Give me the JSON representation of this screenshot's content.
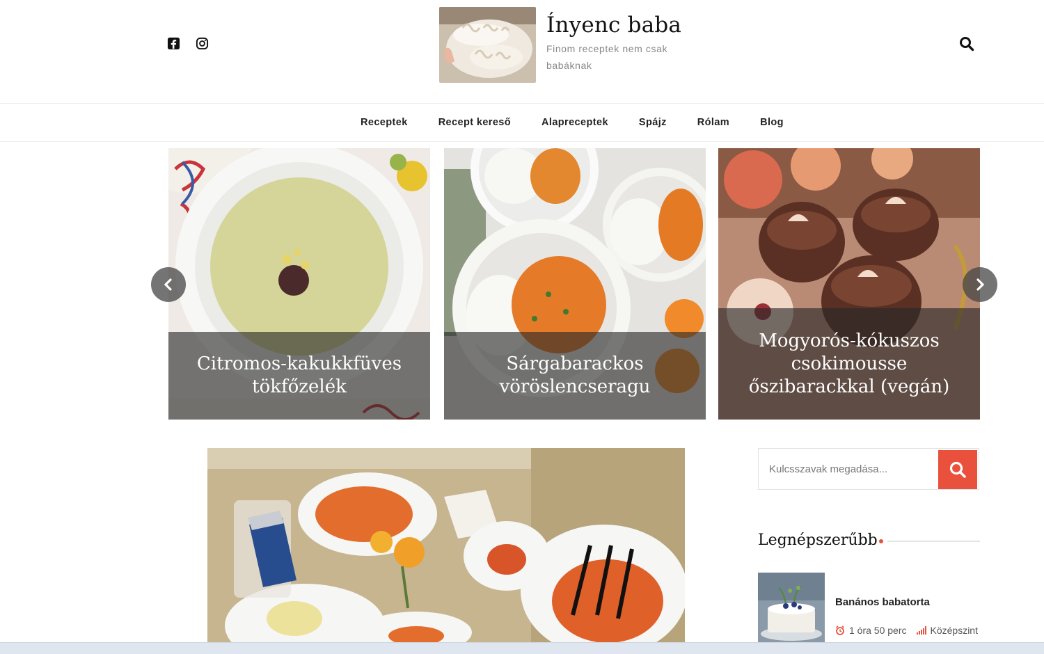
{
  "header": {
    "site_title": "Ínyenc baba",
    "tagline": "Finom receptek nem csak babáknak",
    "social": [
      "facebook-icon",
      "instagram-icon"
    ],
    "search_icon": "search-icon"
  },
  "nav": {
    "items": [
      "Receptek",
      "Recept kereső",
      "Alapreceptek",
      "Spájz",
      "Rólam",
      "Blog"
    ]
  },
  "slider": {
    "slides": [
      {
        "caption": "Citromos-kakukkfüves tökfőzelék"
      },
      {
        "caption": "Sárgabarackos vöröslencseragu"
      },
      {
        "caption": "Mogyorós-kókuszos csokimousse őszibarackkal (vegán)"
      }
    ],
    "prev_icon": "chevron-left-icon",
    "next_icon": "chevron-right-icon"
  },
  "sidebar": {
    "search": {
      "placeholder": "Kulcsszavak megadása..."
    },
    "popular": {
      "title": "Legnépszerűbb",
      "items": [
        {
          "title": "Banános babatorta",
          "time": "1 óra 50 perc",
          "difficulty": "Középszint"
        }
      ]
    }
  },
  "colors": {
    "accent": "#e9513c",
    "text": "#222222"
  }
}
